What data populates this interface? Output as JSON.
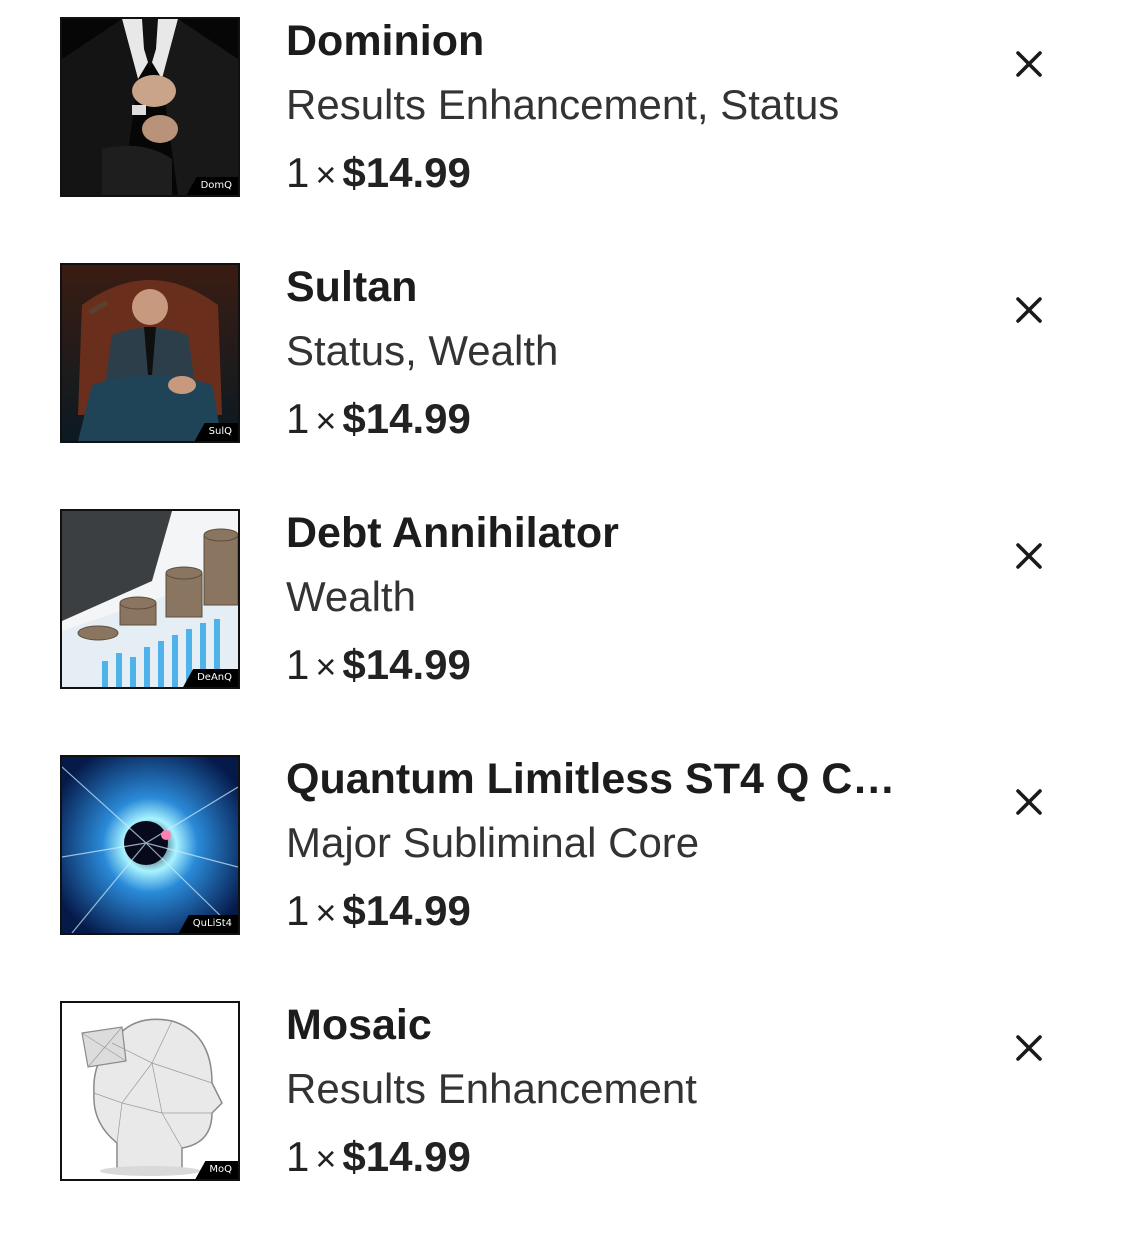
{
  "cart": {
    "items": [
      {
        "name": "Dominion",
        "tags": "Results Enhancement, Status",
        "quantity": "1",
        "times": "×",
        "price": "$14.99",
        "thumb_code": "DomQ",
        "thumb_icon": "suit-cufflinks-image"
      },
      {
        "name": "Sultan",
        "tags": "Status, Wealth",
        "quantity": "1",
        "times": "×",
        "price": "$14.99",
        "thumb_code": "SulQ",
        "thumb_icon": "man-in-armchair-image"
      },
      {
        "name": "Debt Annihilator",
        "tags": "Wealth",
        "quantity": "1",
        "times": "×",
        "price": "$14.99",
        "thumb_code": "DeAnQ",
        "thumb_icon": "coin-stacks-image"
      },
      {
        "name": "Quantum Limitless ST4 Q C…",
        "tags": "Major Subliminal Core",
        "quantity": "1",
        "times": "×",
        "price": "$14.99",
        "thumb_code": "QuLiSt4",
        "thumb_icon": "space-warp-image"
      },
      {
        "name": "Mosaic",
        "tags": "Results Enhancement",
        "quantity": "1",
        "times": "×",
        "price": "$14.99",
        "thumb_code": "MoQ",
        "thumb_icon": "puzzle-head-image"
      }
    ],
    "remove_icon": "close-icon"
  }
}
